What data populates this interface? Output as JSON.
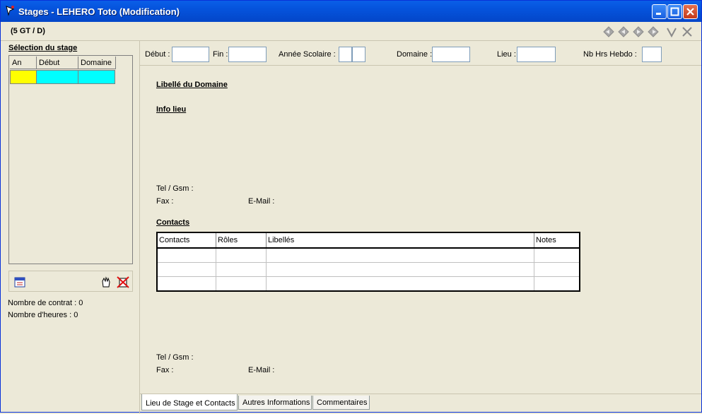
{
  "window": {
    "title": "Stages - LEHERO Toto (Modification)",
    "subtitle": "(5 GT / D)"
  },
  "left": {
    "selection_title": "Sélection du stage",
    "grid_columns": [
      "An",
      "Début",
      "Domaine"
    ],
    "row_colors": [
      "#ffff00",
      "#00ffff",
      "#00ffff"
    ],
    "contract_count_label": "Nombre de contrat :",
    "contract_count_value": "0",
    "hours_label": "Nombre d'heures :",
    "hours_value": "0"
  },
  "filters": {
    "debut_label": "Début :",
    "debut_value": "",
    "fin_label": "Fin :",
    "fin_value": "",
    "annee_label": "Année Scolaire :",
    "annee_value_1": "",
    "annee_value_2": "",
    "domaine_label": "Domaine :",
    "domaine_value": "",
    "lieu_label": "Lieu :",
    "lieu_value": "",
    "hrs_label": "Nb Hrs Hebdo :",
    "hrs_value": ""
  },
  "panel": {
    "domaine_title": "Libellé du Domaine",
    "info_lieu_title": "Info lieu",
    "tel_label": "Tel / Gsm :",
    "fax_label": "Fax :",
    "email_label": "E-Mail :",
    "contacts_title": "Contacts",
    "contacts_columns": [
      "Contacts",
      "Rôles",
      "Libellés",
      "Notes"
    ],
    "contacts_rows": [
      [
        "",
        "",
        "",
        ""
      ],
      [
        "",
        "",
        "",
        ""
      ],
      [
        "",
        "",
        "",
        ""
      ]
    ],
    "tel2_label": "Tel / Gsm :",
    "fax2_label": "Fax :",
    "email2_label": "E-Mail :"
  },
  "tabs": [
    "Lieu de Stage et Contacts",
    "Autres Informations",
    "Commentaires"
  ],
  "icons": {
    "app": "stages-app-icon",
    "nav": [
      "first-record-icon",
      "previous-record-icon",
      "next-record-icon",
      "last-record-icon"
    ],
    "confirm": "check-icon",
    "cancel": "cancel-icon",
    "calendar": "calendar-icon",
    "hand": "hand-icon",
    "delete": "delete-icon"
  },
  "colors": {
    "title_bar": "#0553dc",
    "face": "#ece9d8",
    "selected_year": "#ffff00",
    "selected_cells": "#00ffff"
  }
}
